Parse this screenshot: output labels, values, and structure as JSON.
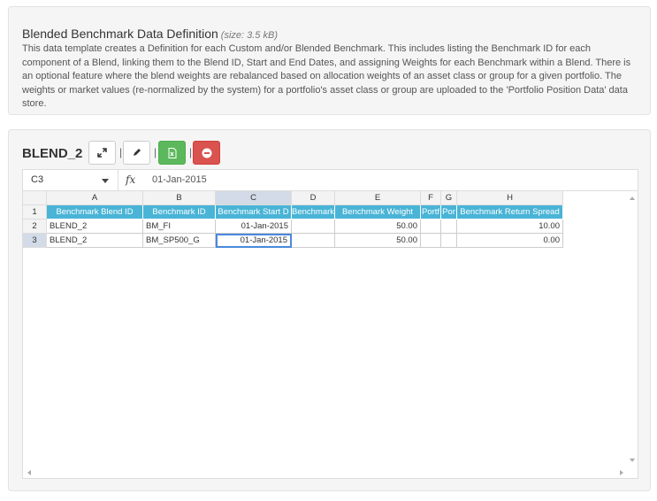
{
  "info": {
    "title": "Blended Benchmark Data Definition",
    "size": "(size: 3.5 kB)",
    "description": "This data template creates a Definition for each Custom and/or Blended Benchmark. This includes listing the Benchmark ID for each component of a Blend, linking them to the Blend ID, Start and End Dates, and assigning Weights for each Benchmark within a Blend. There is an optional feature where the blend weights are rebalanced based on allocation weights of an asset class or group for a given portfolio. The weights or market values (re-normalized by the system) for a portfolio's asset class or group are uploaded to the 'Portfolio Position Data' data store."
  },
  "sheet": {
    "title": "BLEND_2",
    "toolbar": {
      "expand_icon": "expand-arrows-icon",
      "edit_icon": "pencil-icon",
      "excel_icon": "excel-file-icon",
      "remove_icon": "minus-circle-icon",
      "separator": "|"
    },
    "formula_bar": {
      "cell_ref": "C3",
      "fx": "fx",
      "value": "01-Jan-2015"
    },
    "columns": [
      "A",
      "B",
      "C",
      "D",
      "E",
      "F",
      "G",
      "H"
    ],
    "rows": [
      "1",
      "2",
      "3"
    ],
    "headers": [
      "Benchmark Blend ID",
      "Benchmark ID",
      "Benchmark Start D",
      "Benchmark",
      "Benchmark Weight",
      "Portf",
      "Por",
      "Benchmark Return Spread"
    ],
    "data": [
      [
        "BLEND_2",
        "BM_FI",
        "01-Jan-2015",
        "",
        "50.00",
        "",
        "",
        "10.00"
      ],
      [
        "BLEND_2",
        "BM_SP500_G",
        "01-Jan-2015",
        "",
        "50.00",
        "",
        "",
        "0.00"
      ]
    ],
    "active_cell": "C3"
  },
  "colors": {
    "header_blue": "#49b4d6",
    "excel_green": "#5cb85c",
    "remove_red": "#d9534f",
    "selection": "#4b89dc"
  }
}
